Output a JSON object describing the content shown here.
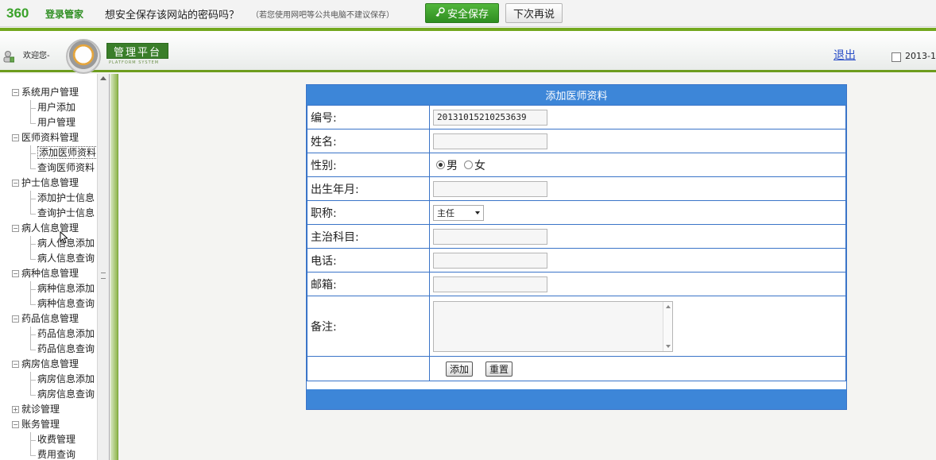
{
  "password_bar": {
    "logo": "360",
    "logo_sub": "登录管家",
    "question": "想安全保存该网站的密码吗？",
    "hint": "（若您使用网吧等公共电脑不建议保存）",
    "save_label": "安全保存",
    "later_label": "下次再说"
  },
  "header": {
    "welcome": "欢迎您-",
    "title": "管理平台",
    "subtitle": "PLATFORM SYSTEM",
    "logout": "退出",
    "date": "2013-1"
  },
  "sidebar": {
    "groups": [
      {
        "label": "系统用户管理",
        "children": [
          "用户添加",
          "用户管理"
        ]
      },
      {
        "label": "医师资料管理",
        "children": [
          "添加医师资料",
          "查询医师资料"
        ]
      },
      {
        "label": "护士信息管理",
        "children": [
          "添加护士信息",
          "查询护士信息"
        ]
      },
      {
        "label": "病人信息管理",
        "children": [
          "病人信息添加",
          "病人信息查询"
        ]
      },
      {
        "label": "病种信息管理",
        "children": [
          "病种信息添加",
          "病种信息查询"
        ]
      },
      {
        "label": "药品信息管理",
        "children": [
          "药品信息添加",
          "药品信息查询"
        ]
      },
      {
        "label": "病房信息管理",
        "children": [
          "病房信息添加",
          "病房信息查询"
        ]
      },
      {
        "label": "就诊管理",
        "children": []
      },
      {
        "label": "账务管理",
        "children": [
          "收费管理",
          "费用查询"
        ]
      }
    ]
  },
  "form": {
    "title": "添加医师资料",
    "fields": {
      "id": {
        "label": "编号:",
        "value": "20131015210253639"
      },
      "name": {
        "label": "姓名:",
        "value": ""
      },
      "gender": {
        "label": "性别:",
        "options": [
          "男",
          "女"
        ],
        "selected": "男"
      },
      "birth": {
        "label": "出生年月:",
        "value": ""
      },
      "title": {
        "label": "职称:",
        "value": "主任"
      },
      "subject": {
        "label": "主治科目:",
        "value": ""
      },
      "phone": {
        "label": "电话:",
        "value": ""
      },
      "email": {
        "label": "邮箱:",
        "value": ""
      },
      "note": {
        "label": "备注:",
        "value": ""
      }
    },
    "add_label": "添加",
    "reset_label": "重置"
  }
}
